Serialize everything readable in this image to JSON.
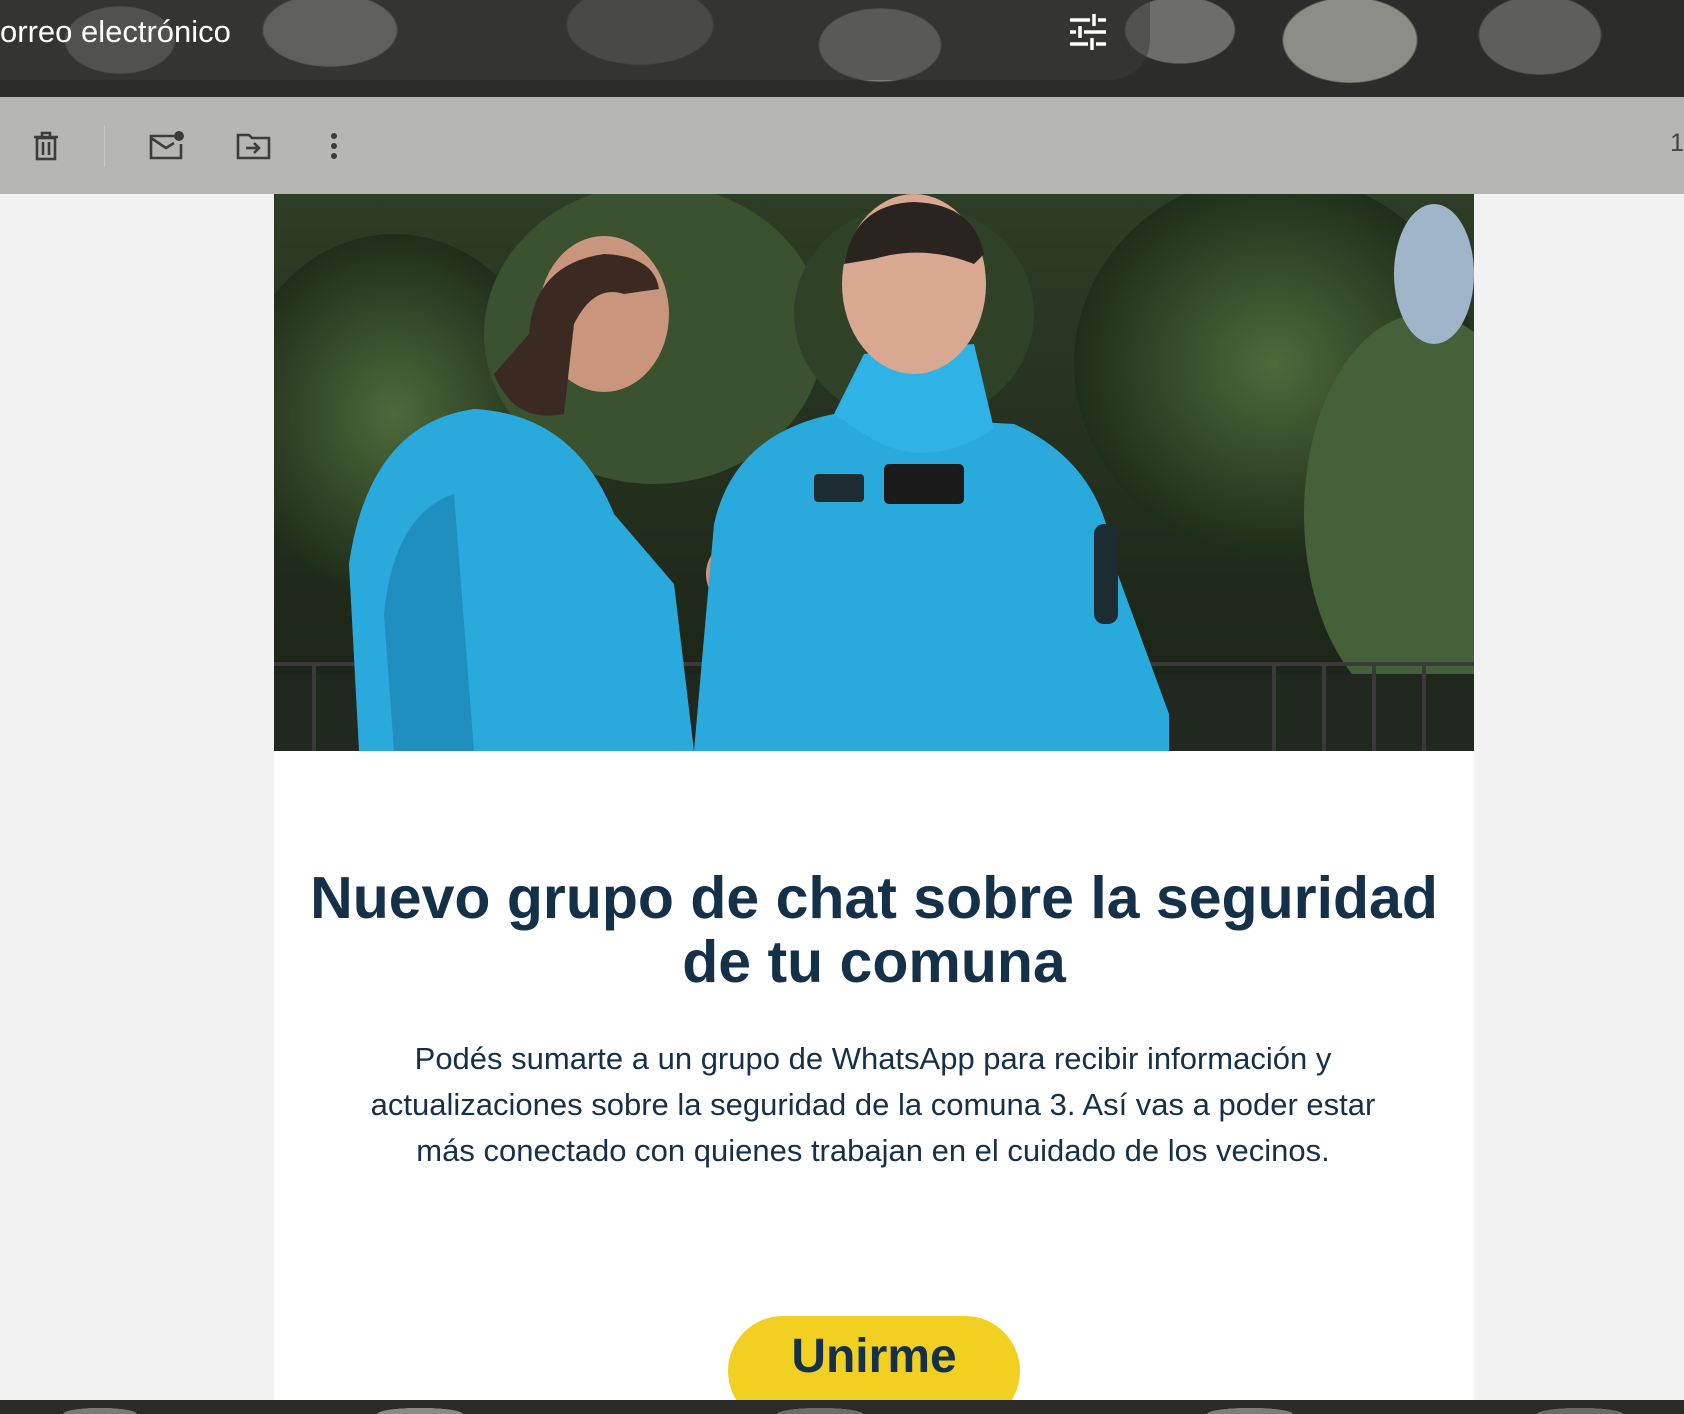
{
  "search": {
    "text": "orreo electrónico"
  },
  "icons": {
    "tune": "tune-icon",
    "delete": "trash-icon",
    "mark_unread": "mark-unread-icon",
    "move": "move-to-folder-icon",
    "more": "more-vertical-icon"
  },
  "toolbar": {
    "page_count": "1"
  },
  "email": {
    "hero_image": "hero-photo-two-security-officers",
    "headline": "Nuevo grupo de chat sobre la seguridad de tu comuna",
    "body": "Podés sumarte a un grupo de WhatsApp para recibir información y actualizaciones sobre la seguridad de la comuna 3. Así vas a poder estar más conectado con quienes trabajan en el cuidado de los vecinos.",
    "cta_label": "Unirme"
  },
  "colors": {
    "headline": "#153049",
    "cta": "#f2d022",
    "jacket": "#2aa9dc"
  }
}
